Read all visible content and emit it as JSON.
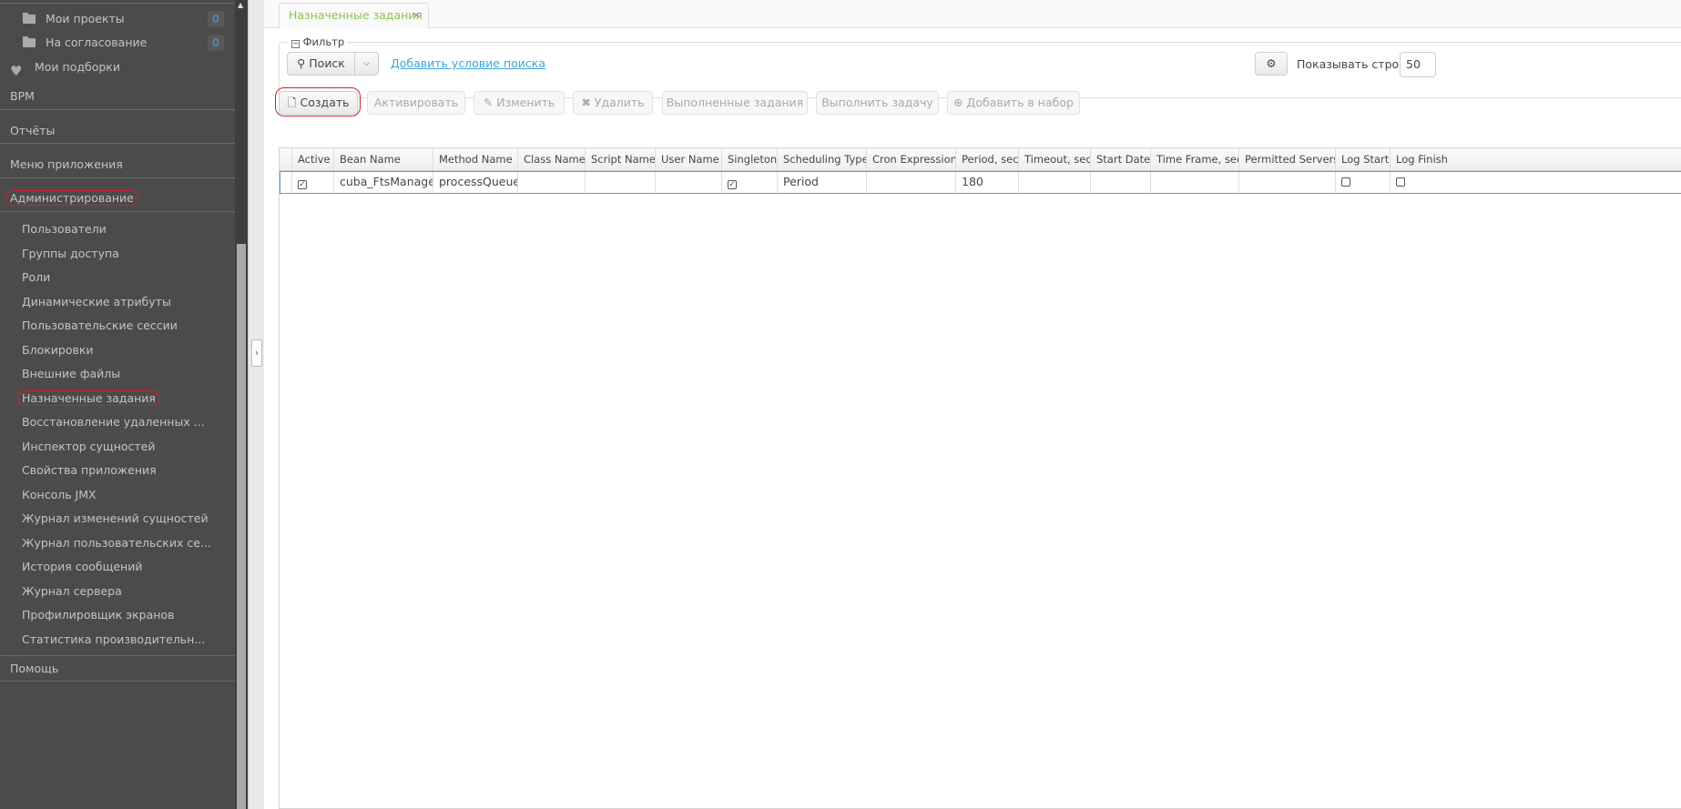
{
  "sidebar": {
    "folders": [
      {
        "label": "Мои проекты",
        "count": "0"
      },
      {
        "label": "На согласование",
        "count": "0"
      }
    ],
    "favorites": "Мои подборки",
    "sections": [
      "BPM",
      "Отчёты",
      "Меню приложения",
      "Администрирование"
    ],
    "admin_items": [
      "Пользователи",
      "Группы доступа",
      "Роли",
      "Динамические атрибуты",
      "Пользовательские сессии",
      "Блокировки",
      "Внешние файлы",
      "Назначенные задания",
      "Восстановление удаленных ...",
      "Инспектор сущностей",
      "Свойства приложения",
      "Консоль JMX",
      "Журнал изменений сущностей",
      "Журнал пользовательских се...",
      "История сообщений",
      "Журнал сервера",
      "Профилировщик экранов",
      "Статистика производительн..."
    ],
    "help": "Помощь"
  },
  "tab": {
    "title": "Назначенные задания",
    "close": "×"
  },
  "filter": {
    "legend": "Фильтр",
    "search_label": "Поиск",
    "add_condition": "Добавить условие поиска",
    "rows_label": "Показывать строк",
    "rows_value": "50"
  },
  "toolbar": {
    "create": "Создать",
    "activate": "Активировать",
    "edit": "Изменить",
    "delete": "Удалить",
    "executions": "Выполненные задания",
    "execute": "Выполнить задачу",
    "add_to_set": "Добавить в набор"
  },
  "table": {
    "columns": [
      "Active",
      "Bean Name",
      "Method Name",
      "Class Name",
      "Script Name",
      "User Name",
      "Singleton",
      "Scheduling Type",
      "Cron Expression",
      "Period, sec",
      "Timeout, sec",
      "Start Date",
      "Time Frame, sec",
      "Permitted Servers",
      "Log Start",
      "Log Finish"
    ],
    "rows": [
      {
        "active": true,
        "bean": "cuba_FtsManager",
        "method": "processQueue",
        "class": "",
        "script": "",
        "user": "",
        "singleton": true,
        "type": "Period",
        "cron": "",
        "period": "180",
        "timeout": "",
        "start": "",
        "frame": "",
        "servers": "",
        "log_start": false,
        "log_finish": false
      }
    ]
  },
  "colors": {
    "sidebar_bg": "#4b4b4b",
    "accent": "#3fa4d9",
    "tab_title": "#8cc152",
    "highlight": "#d0222a"
  }
}
